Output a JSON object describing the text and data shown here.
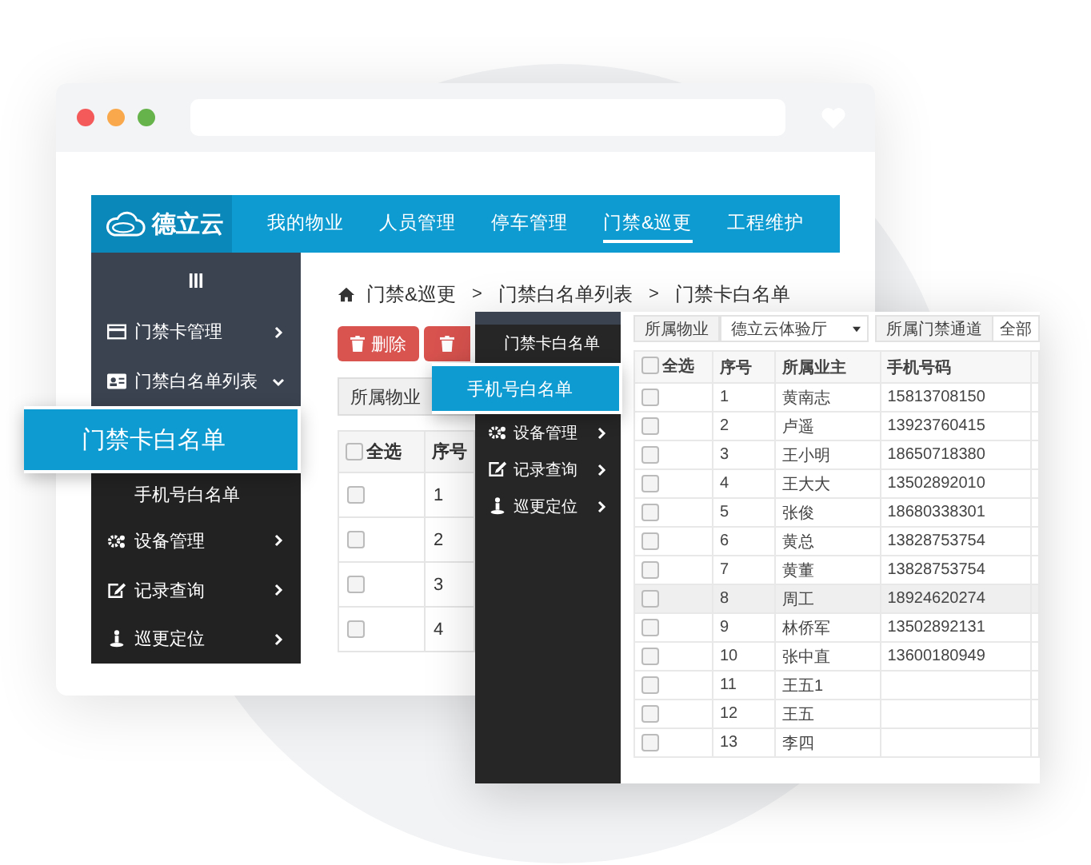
{
  "app": {
    "brand": "德立云",
    "nav": [
      {
        "label": "我的物业",
        "selected": false
      },
      {
        "label": "人员管理",
        "selected": false
      },
      {
        "label": "停车管理",
        "selected": false
      },
      {
        "label": "门禁&巡更",
        "selected": true
      },
      {
        "label": "工程维护",
        "selected": false
      }
    ],
    "sidebar": [
      {
        "kind": "menu",
        "label": "门禁卡管理",
        "expanded": false
      },
      {
        "kind": "menu",
        "label": "门禁白名单列表",
        "expanded": true
      },
      {
        "kind": "sub",
        "label": "门禁卡白名单",
        "selected": true
      },
      {
        "kind": "sub",
        "label": "手机号白名单",
        "selected": false
      },
      {
        "kind": "menu",
        "label": "设备管理",
        "expanded": false
      },
      {
        "kind": "menu",
        "label": "记录查询",
        "expanded": false
      },
      {
        "kind": "menu",
        "label": "巡更定位",
        "expanded": false
      }
    ],
    "breadcrumb": [
      {
        "kind": "crumb",
        "text": "门禁&巡更"
      },
      {
        "kind": "sep",
        "text": ">"
      },
      {
        "kind": "crumb",
        "text": "门禁白名单列表"
      },
      {
        "kind": "sep",
        "text": ">"
      },
      {
        "kind": "crumb",
        "text": "门禁卡白名单"
      }
    ],
    "buttons": [
      {
        "kind": "labeled",
        "label": "删除"
      },
      {
        "kind": "icon_only"
      }
    ],
    "filter": {
      "label": "所属物业"
    },
    "table": {
      "columns": [
        "全选",
        "序号"
      ],
      "all_checked": false,
      "rows": [
        {
          "checked": false,
          "no": "1"
        },
        {
          "checked": false,
          "no": "2"
        },
        {
          "checked": false,
          "no": "3"
        },
        {
          "checked": false,
          "no": "4"
        }
      ]
    }
  },
  "panel": {
    "sidebar": [
      {
        "kind": "sub",
        "label": "门禁卡白名单",
        "selected": false
      },
      {
        "kind": "sub",
        "label": "手机号白名单",
        "selected": true
      },
      {
        "kind": "menu",
        "label": "设备管理",
        "expanded": false
      },
      {
        "kind": "menu",
        "label": "记录查询",
        "expanded": false
      },
      {
        "kind": "menu",
        "label": "巡更定位",
        "expanded": false
      }
    ],
    "filters": [
      {
        "kind": "label",
        "text": "所属物业"
      },
      {
        "kind": "select",
        "text": "德立云体验厅"
      },
      {
        "kind": "label",
        "text": "所属门禁通道"
      },
      {
        "kind": "value",
        "text": "全部"
      }
    ],
    "table": {
      "columns": [
        "全选",
        "序号",
        "所属业主",
        "手机号码"
      ],
      "all_checked": false,
      "rows": [
        {
          "checked": false,
          "selected": false,
          "no": "1",
          "owner": "黄南志",
          "phone": "15813708150"
        },
        {
          "checked": false,
          "selected": false,
          "no": "2",
          "owner": "卢遥",
          "phone": "13923760415"
        },
        {
          "checked": false,
          "selected": false,
          "no": "3",
          "owner": "王小明",
          "phone": "18650718380"
        },
        {
          "checked": false,
          "selected": false,
          "no": "4",
          "owner": "王大大",
          "phone": "13502892010"
        },
        {
          "checked": false,
          "selected": false,
          "no": "5",
          "owner": "张俊",
          "phone": "18680338301"
        },
        {
          "checked": false,
          "selected": false,
          "no": "6",
          "owner": "黄总",
          "phone": "13828753754"
        },
        {
          "checked": false,
          "selected": false,
          "no": "7",
          "owner": "黄董",
          "phone": "13828753754"
        },
        {
          "checked": false,
          "selected": true,
          "no": "8",
          "owner": "周工",
          "phone": "18924620274"
        },
        {
          "checked": false,
          "selected": false,
          "no": "9",
          "owner": "林侨军",
          "phone": "13502892131"
        },
        {
          "checked": false,
          "selected": false,
          "no": "10",
          "owner": "张中直",
          "phone": "13600180949"
        },
        {
          "checked": false,
          "selected": false,
          "no": "11",
          "owner": "王五1",
          "phone": ""
        },
        {
          "checked": false,
          "selected": false,
          "no": "12",
          "owner": "王五",
          "phone": ""
        },
        {
          "checked": false,
          "selected": false,
          "no": "13",
          "owner": "李四",
          "phone": ""
        }
      ]
    }
  }
}
